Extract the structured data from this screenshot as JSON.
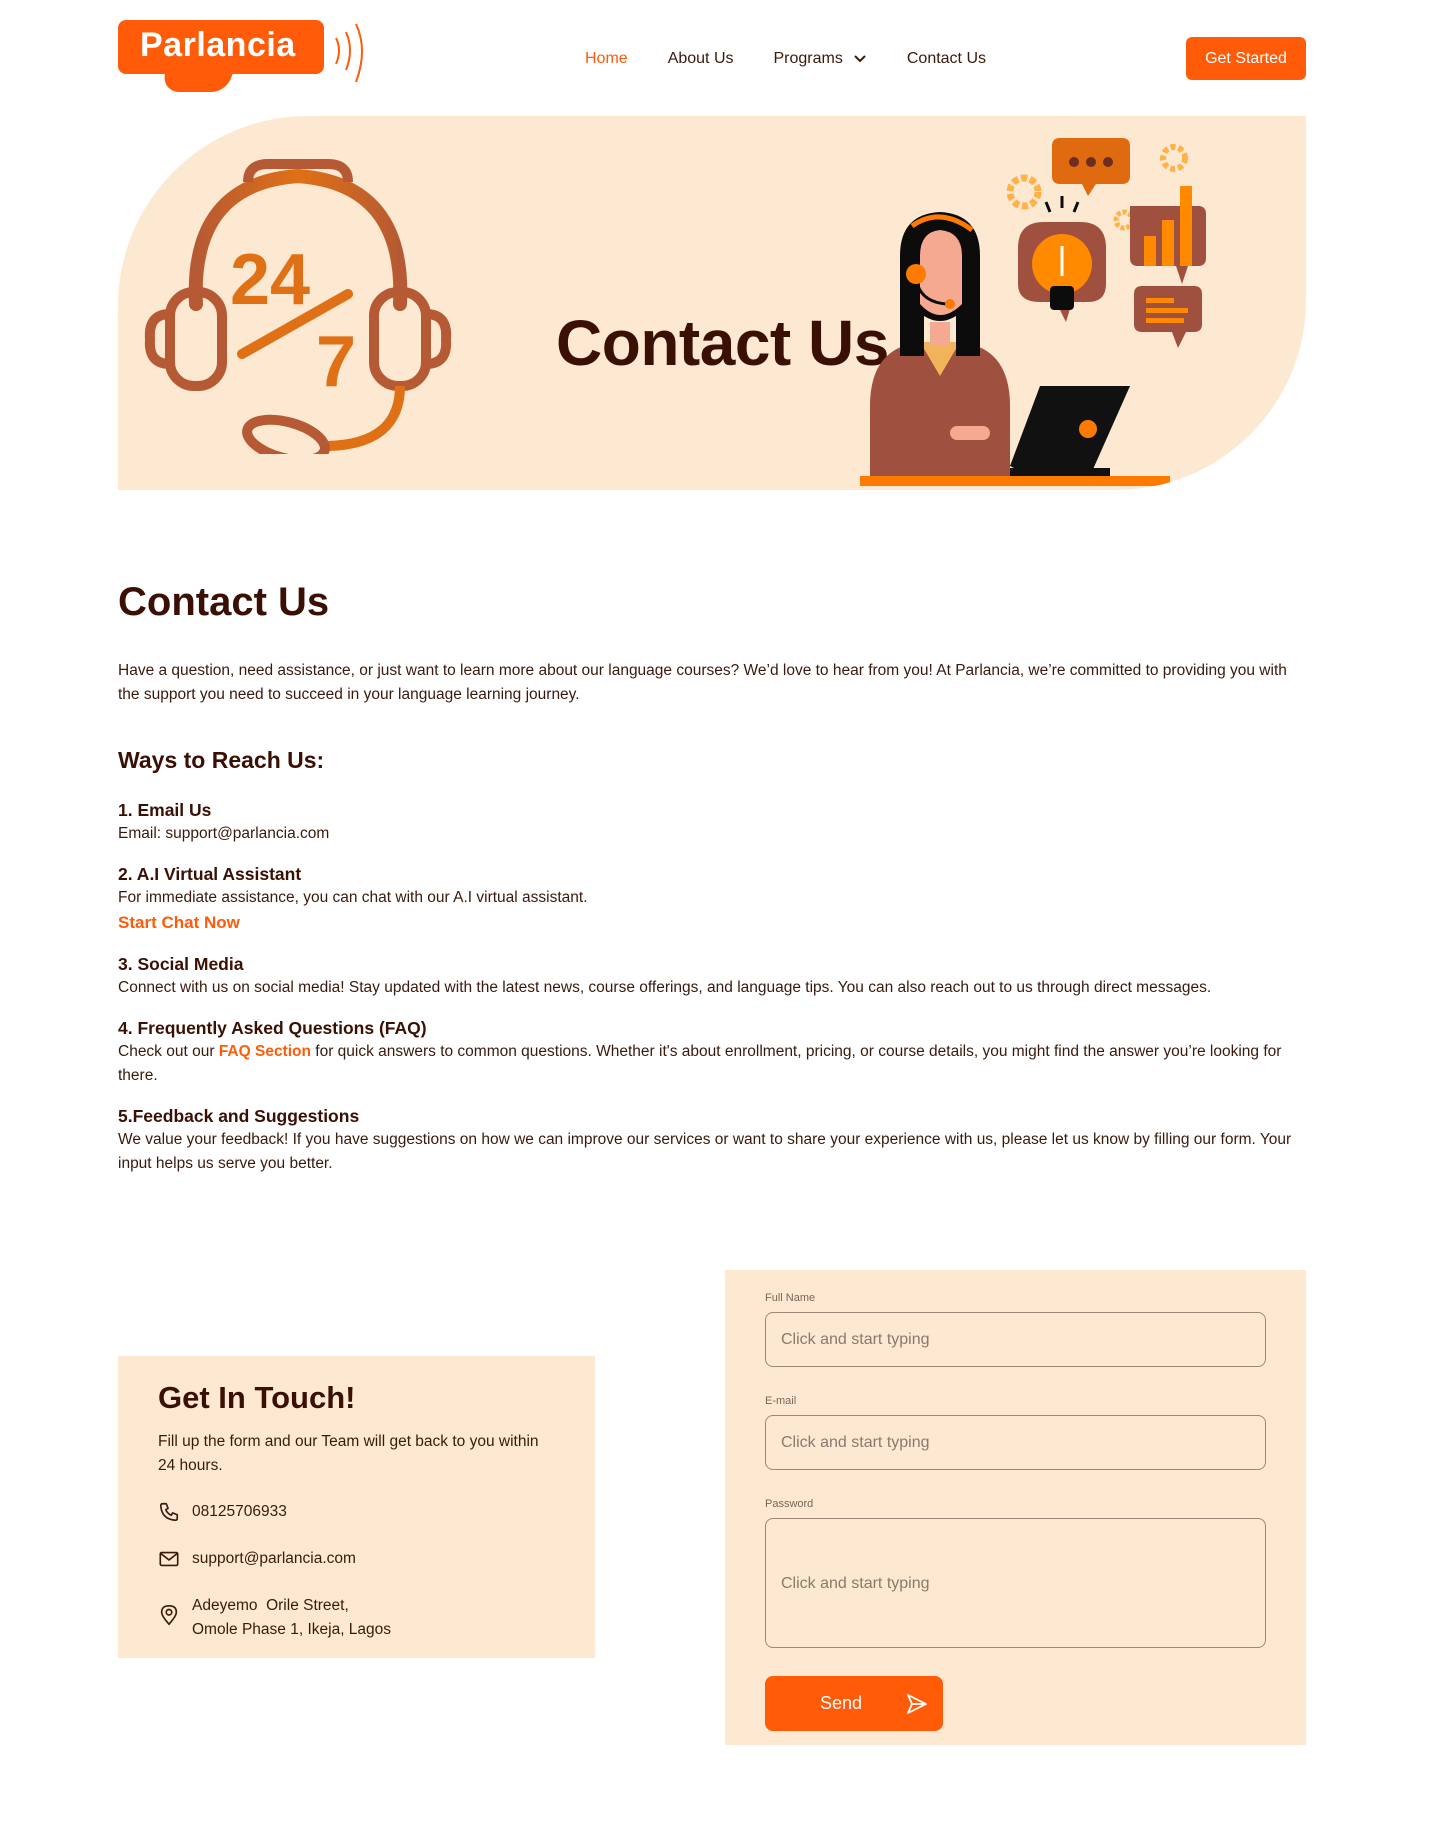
{
  "brand": {
    "name": "Parlancia"
  },
  "nav": {
    "items": [
      {
        "label": "Home",
        "active": true
      },
      {
        "label": "About Us",
        "active": false
      },
      {
        "label": "Programs",
        "active": false
      },
      {
        "label": "Contact Us",
        "active": false
      }
    ],
    "cta": "Get Started"
  },
  "hero": {
    "title": "Contact Us",
    "headset_text_top": "24",
    "headset_text_bottom": "7"
  },
  "main": {
    "title": "Contact Us",
    "intro": "Have a question, need assistance, or just want to learn more about our language courses? We’d love to hear from you! At Parlancia, we’re committed to providing you with the support you need to succeed in your language learning journey.",
    "ways_title": "Ways to Reach Us:",
    "ways": [
      {
        "title": "1. Email Us",
        "text": "Email: support@parlancia.com"
      },
      {
        "title": "2. A.I Virtual Assistant",
        "text": "For immediate assistance, you can chat with our A.I virtual assistant.",
        "link": "Start Chat Now"
      },
      {
        "title": "3. Social Media",
        "text": "Connect with us on social media! Stay updated with the latest news, course offerings, and language tips. You can also reach out to us through direct messages."
      },
      {
        "title": "4. Frequently Asked Questions (FAQ)",
        "text_before": "Check out our",
        "link": "FAQ Section",
        "text_after": "for quick answers to common questions. Whether it's about enrollment, pricing, or course details, you might find the answer you’re looking for there."
      },
      {
        "title": "5.Feedback and Suggestions",
        "text": "We value your feedback! If you have suggestions on how we can improve our services or want to share your experience with us, please let us know by filling our form. Your input helps us serve you better."
      }
    ]
  },
  "touch": {
    "title": "Get In Touch!",
    "desc": "Fill up the form and our Team will get back to you within 24 hours.",
    "phone": "08125706933",
    "email": "support@parlancia.com",
    "address_line1": "Adeyemo  Orile Street,",
    "address_line2": "Omole Phase 1, Ikeja, Lagos"
  },
  "form": {
    "fields": [
      {
        "label": "Full Name",
        "placeholder": "Click and start typing"
      },
      {
        "label": "E-mail",
        "placeholder": "Click and start typing"
      },
      {
        "label": "Password",
        "placeholder": "Click and start typing"
      }
    ],
    "submit": "Send"
  },
  "colors": {
    "accent": "#ff5b08",
    "panel": "#fde9d1",
    "heading": "#3a1005"
  },
  "icons": [
    "chevron-down-icon",
    "phone-icon",
    "mail-icon",
    "location-pin-icon",
    "send-icon",
    "sound-waves-icon"
  ]
}
